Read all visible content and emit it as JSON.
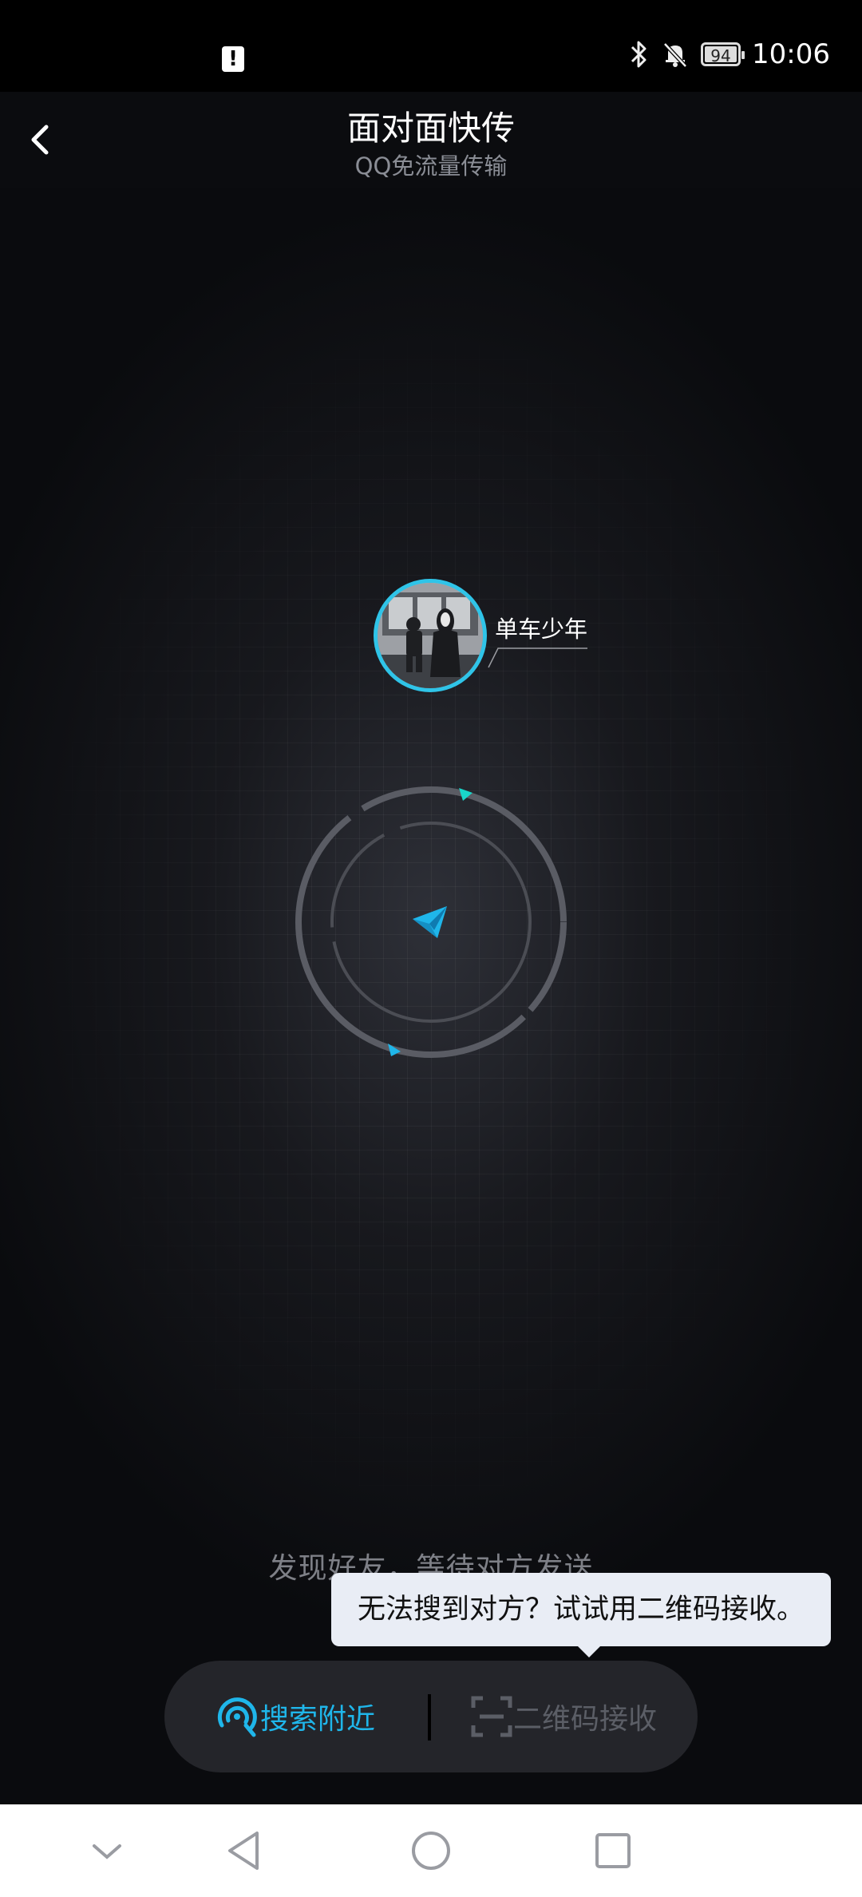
{
  "status_bar": {
    "alert_glyph": "!",
    "battery": "94",
    "time": "10:06",
    "icons": [
      "bluetooth-icon",
      "mute-bell-icon",
      "battery-icon"
    ]
  },
  "header": {
    "title": "面对面快传",
    "subtitle": "QQ免流量传输"
  },
  "nearby_user": {
    "name": "单车少年"
  },
  "status_text": "发现好友，等待对方发送",
  "tooltip": "无法搜到对方？试试用二维码接收。",
  "actions": {
    "search_nearby": "搜索附近",
    "qr_receive": "二维码接收"
  },
  "colors": {
    "accent": "#1fb6ea",
    "ring": "#5a5c64",
    "marker": "#19d6c9"
  }
}
